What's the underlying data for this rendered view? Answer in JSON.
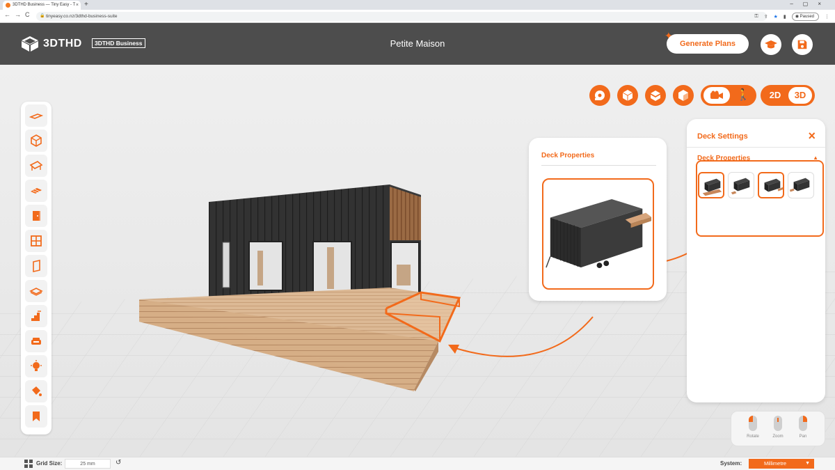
{
  "browser": {
    "tab_title": "3DTHD Business — Tiny Easy - T",
    "tab_close": "×",
    "new_tab": "+",
    "window_controls": "–▢×",
    "nav": "←→C",
    "url": "tinyeasy.co.nz/3dthd-business-suite",
    "paused_label": "Paused"
  },
  "header": {
    "logo_text": "3DTHD",
    "badge": "3DTHD Business",
    "project_title": "Petite Maison",
    "generate_label": "Generate Plans"
  },
  "view_toggle": {
    "two_d": "2D",
    "three_d": "3D"
  },
  "deck_popup": {
    "title": "Deck Properties"
  },
  "deck_panel": {
    "title": "Deck Settings",
    "close": "×",
    "section": "Deck Properties",
    "caret": "▲"
  },
  "mouse_hints": {
    "rotate": "Rotate",
    "zoom": "Zoom",
    "pan": "Pan"
  },
  "statusbar": {
    "grid_label": "Grid Size:",
    "grid_value": "25 mm",
    "reset": "↺",
    "system_label": "System:",
    "system_value": "Millimetre",
    "dropdown": "▼"
  },
  "colors": {
    "accent": "#f26a1b",
    "header": "#4d4d4d",
    "cladding": "#2e2e2e",
    "deck": "#d9b592"
  }
}
